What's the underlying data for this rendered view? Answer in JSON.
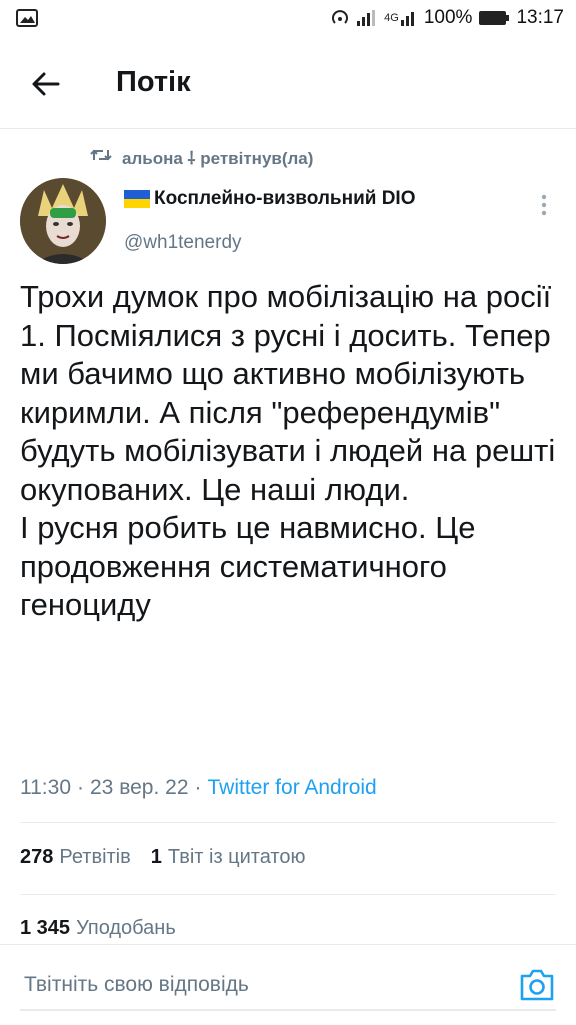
{
  "status_bar": {
    "battery_percent": "100%",
    "time": "13:17",
    "network": "4G"
  },
  "header": {
    "title": "Потік"
  },
  "retweet_context": {
    "text": "альона ⸸ ретвітнув(ла)"
  },
  "tweet": {
    "display_name": "Косплейно-визвольний DIO",
    "handle": "@wh1tenerdy",
    "text": "Трохи думок про мобілізацію на росії\n1. Посміялися з русні і досить. Тепер ми бачимо що активно мобілізують киримли. А після \"референдумів\" будуть мобілізувати і людей на решті окупованих. Це наші люди.\nІ русня робить це навмисно. Це продовження систематичного геноциду",
    "time": "11:30",
    "date": "23 вер. 22",
    "source": "Twitter for Android",
    "separator": "·"
  },
  "stats": {
    "retweets_count": "278",
    "retweets_label": "Ретвітів",
    "quotes_count": "1",
    "quotes_label": "Твіт із цитатою",
    "likes_count": "1 345",
    "likes_label": "Уподобань"
  },
  "reply": {
    "placeholder": "Твітніть свою відповідь"
  },
  "colors": {
    "accent": "#1da1f2",
    "muted": "#657786",
    "text": "#14171a"
  }
}
